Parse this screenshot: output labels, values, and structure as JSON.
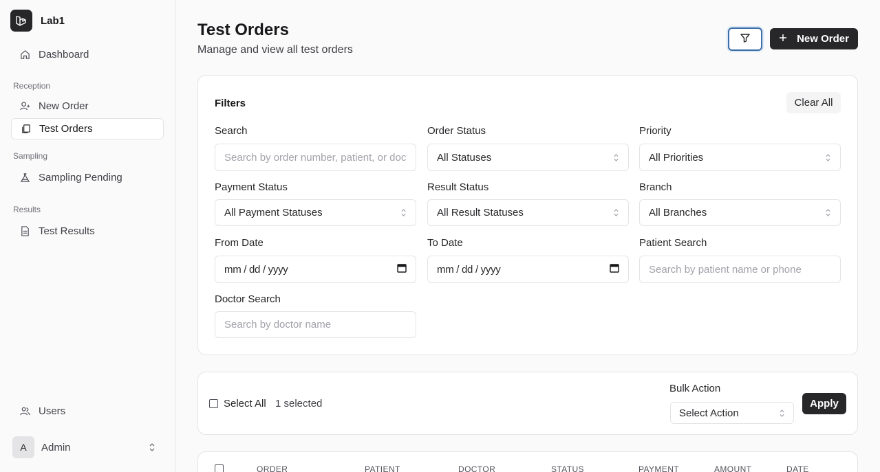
{
  "app": {
    "name": "Lab1"
  },
  "sidebar": {
    "dashboard": "Dashboard",
    "groups": {
      "reception": "Reception",
      "sampling": "Sampling",
      "results": "Results"
    },
    "items": {
      "new_order": "New Order",
      "test_orders": "Test Orders",
      "sampling_pending": "Sampling Pending",
      "test_results": "Test Results",
      "users": "Users"
    },
    "user": {
      "initial": "A",
      "name": "Admin"
    }
  },
  "header": {
    "title": "Test Orders",
    "subtitle": "Manage and view all test orders",
    "new_order_label": "New Order"
  },
  "filters": {
    "title": "Filters",
    "clear_label": "Clear All",
    "search": {
      "label": "Search",
      "placeholder": "Search by order number, patient, or doctor"
    },
    "order_status": {
      "label": "Order Status",
      "value": "All Statuses"
    },
    "priority": {
      "label": "Priority",
      "value": "All Priorities"
    },
    "payment_status": {
      "label": "Payment Status",
      "value": "All Payment Statuses"
    },
    "result_status": {
      "label": "Result Status",
      "value": "All Result Statuses"
    },
    "branch": {
      "label": "Branch",
      "value": "All Branches"
    },
    "from_date": {
      "label": "From Date",
      "value": "mm / dd / yyyy"
    },
    "to_date": {
      "label": "To Date",
      "value": "mm / dd / yyyy"
    },
    "patient_search": {
      "label": "Patient Search",
      "placeholder": "Search by patient name or phone"
    },
    "doctor_search": {
      "label": "Doctor Search",
      "placeholder": "Search by doctor name"
    }
  },
  "bulk": {
    "select_all": "Select All",
    "selected_count": "1 selected",
    "label": "Bulk Action",
    "select_value": "Select Action",
    "apply_label": "Apply"
  },
  "table": {
    "columns": [
      "ORDER",
      "PATIENT",
      "DOCTOR",
      "STATUS",
      "PAYMENT",
      "AMOUNT",
      "DATE"
    ]
  },
  "colors": {
    "primary": "#27272a",
    "focus_ring": "#3b6ea8",
    "border": "#e4e4e7",
    "muted_text": "#71717a"
  }
}
